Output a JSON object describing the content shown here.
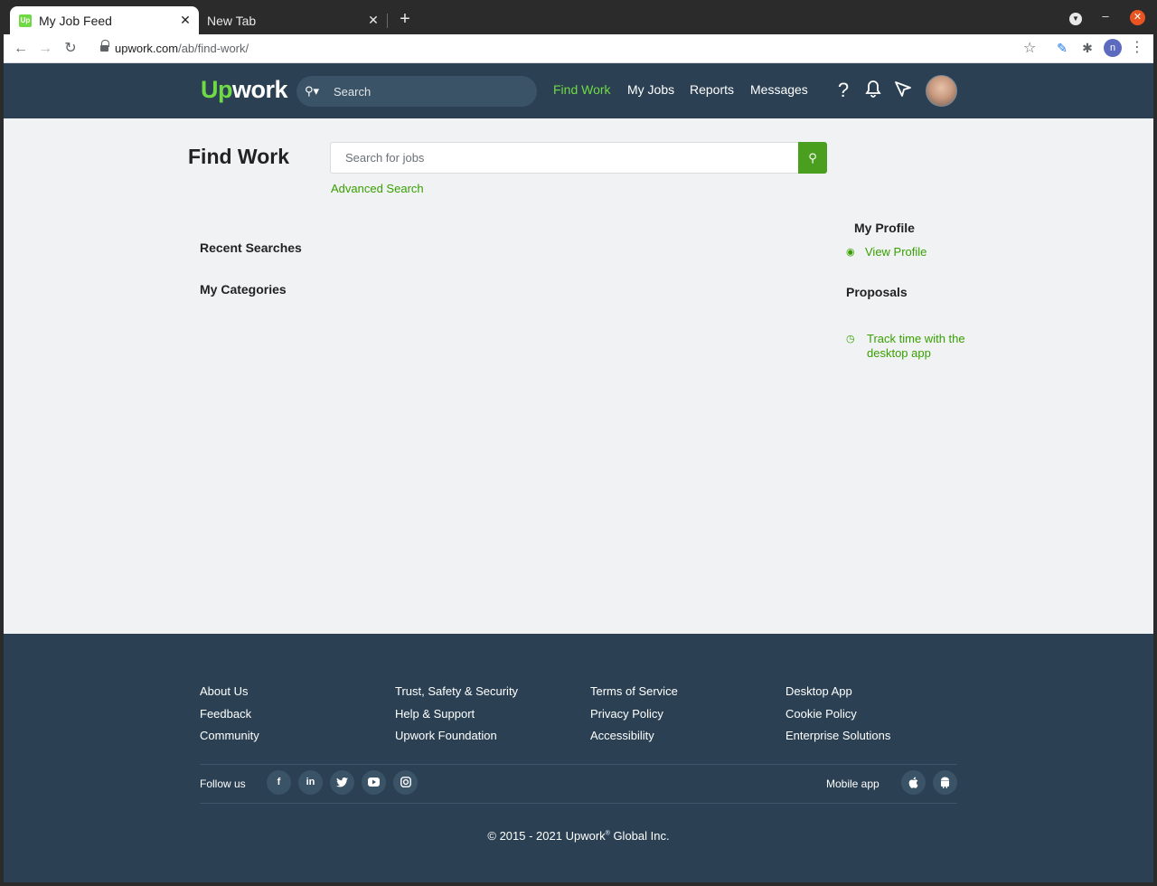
{
  "browser": {
    "tabs": [
      {
        "title": "My Job Feed",
        "favicon": "Up",
        "active": true
      },
      {
        "title": "New Tab",
        "active": false
      }
    ],
    "url_host": "upwork.com",
    "url_path": "/ab/find-work/",
    "profile_initial": "n",
    "icons": {
      "back": "arrow-left-icon",
      "forward": "arrow-right-icon",
      "reload": "reload-icon",
      "bookmark": "star-icon",
      "extension1": "pin-icon",
      "extension2": "puzzle-icon",
      "menu": "kebab-icon"
    }
  },
  "header": {
    "logo_up": "Up",
    "logo_rest": "work",
    "search_placeholder": "Search",
    "nav": [
      {
        "label": "Find Work",
        "active": true
      },
      {
        "label": "My Jobs",
        "active": false
      },
      {
        "label": "Reports",
        "active": false
      },
      {
        "label": "Messages",
        "active": false
      }
    ],
    "icons": [
      "help-icon",
      "bell-icon",
      "send-icon"
    ]
  },
  "main": {
    "title": "Find Work",
    "search_placeholder": "Search for jobs",
    "advanced_search": "Advanced Search",
    "recent_searches": "Recent Searches",
    "my_categories": "My Categories"
  },
  "sidebar": {
    "my_profile": "My Profile",
    "view_profile": "View Profile",
    "proposals": "Proposals",
    "track_time": "Track time with the desktop app"
  },
  "footer": {
    "columns": [
      [
        "About Us",
        "Feedback",
        "Community"
      ],
      [
        "Trust, Safety & Security",
        "Help & Support",
        "Upwork Foundation"
      ],
      [
        "Terms of Service",
        "Privacy Policy",
        "Accessibility"
      ],
      [
        "Desktop App",
        "Cookie Policy",
        "Enterprise Solutions"
      ]
    ],
    "follow_us": "Follow us",
    "social": [
      "facebook-icon",
      "linkedin-icon",
      "twitter-icon",
      "youtube-icon",
      "instagram-icon"
    ],
    "mobile_app": "Mobile app",
    "mobile": [
      "apple-icon",
      "android-icon"
    ],
    "copyright_pre": "© 2015 - 2021 Upwork",
    "copyright_reg": "®",
    "copyright_post": " Global Inc."
  },
  "colors": {
    "brand_green": "#6fda44",
    "link_green": "#37a000",
    "button_green": "#4a9f1e",
    "header_bg": "#2b4153",
    "page_bg": "#f1f2f4"
  }
}
